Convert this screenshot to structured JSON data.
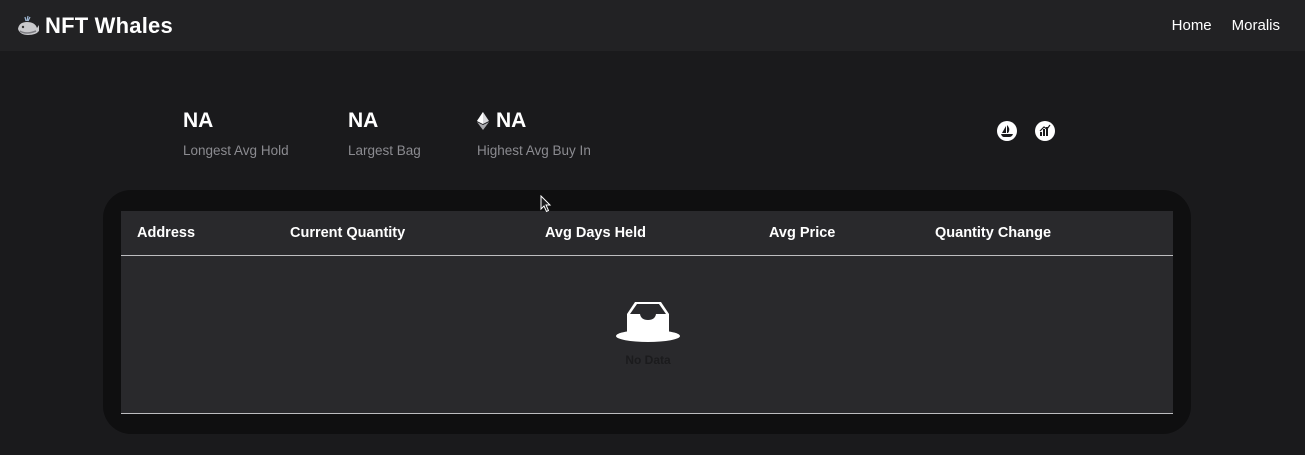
{
  "app": {
    "title": "NFT Whales",
    "logo_icon": "whale-icon"
  },
  "nav": {
    "links": [
      "Home",
      "Moralis"
    ]
  },
  "stats": [
    {
      "value": "NA",
      "label": "Longest Avg Hold"
    },
    {
      "value": "NA",
      "label": "Largest Bag"
    },
    {
      "value": "NA",
      "label": "Highest Avg Buy In",
      "icon": "ethereum-icon"
    }
  ],
  "actions": [
    {
      "icon": "opensea-icon"
    },
    {
      "icon": "chart-icon"
    }
  ],
  "table": {
    "columns": [
      "Address",
      "Current Quantity",
      "Avg Days Held",
      "Avg Price",
      "Quantity Change"
    ],
    "rows": [],
    "empty_text": "No Data",
    "empty_icon": "empty-inbox-icon"
  },
  "colors": {
    "background": "#1a1a1c",
    "navbar": "#222224",
    "table_bg": "#29292c",
    "card_border": "#0f0f10",
    "muted_text": "#8b8b90"
  }
}
